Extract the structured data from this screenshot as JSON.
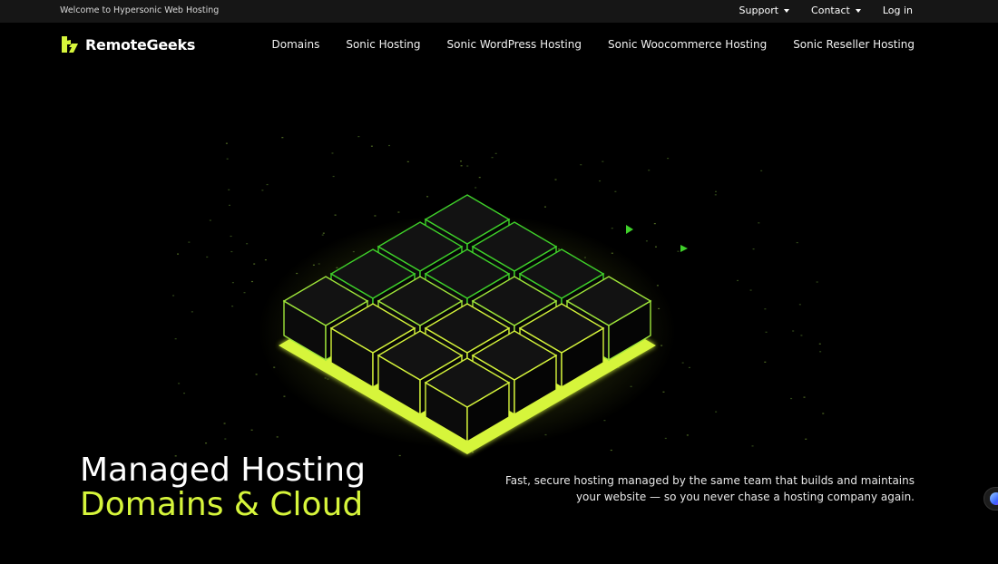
{
  "topbar": {
    "welcome": "Welcome to Hypersonic Web Hosting",
    "links": [
      {
        "label": "Support",
        "dropdown": true
      },
      {
        "label": "Contact",
        "dropdown": true
      },
      {
        "label": "Log in",
        "dropdown": false
      }
    ]
  },
  "brand": {
    "name": "RemoteGeeks",
    "accent_color": "#d6f53b"
  },
  "nav": {
    "items": [
      "Domains",
      "Sonic Hosting",
      "Sonic WordPress Hosting",
      "Sonic Woocommerce Hosting",
      "Sonic Reseller Hosting"
    ]
  },
  "hero": {
    "title_line1": "Managed Hosting",
    "title_line2": "Domains & Cloud",
    "description": "Fast, secure hosting managed by the same team that builds and maintains your website — so you never chase a hosting company again."
  },
  "colors": {
    "background": "#000000",
    "topbar": "#161616",
    "cube_stroke_green": "#3fd12a",
    "cube_stroke_yellow": "#d6f53b"
  }
}
